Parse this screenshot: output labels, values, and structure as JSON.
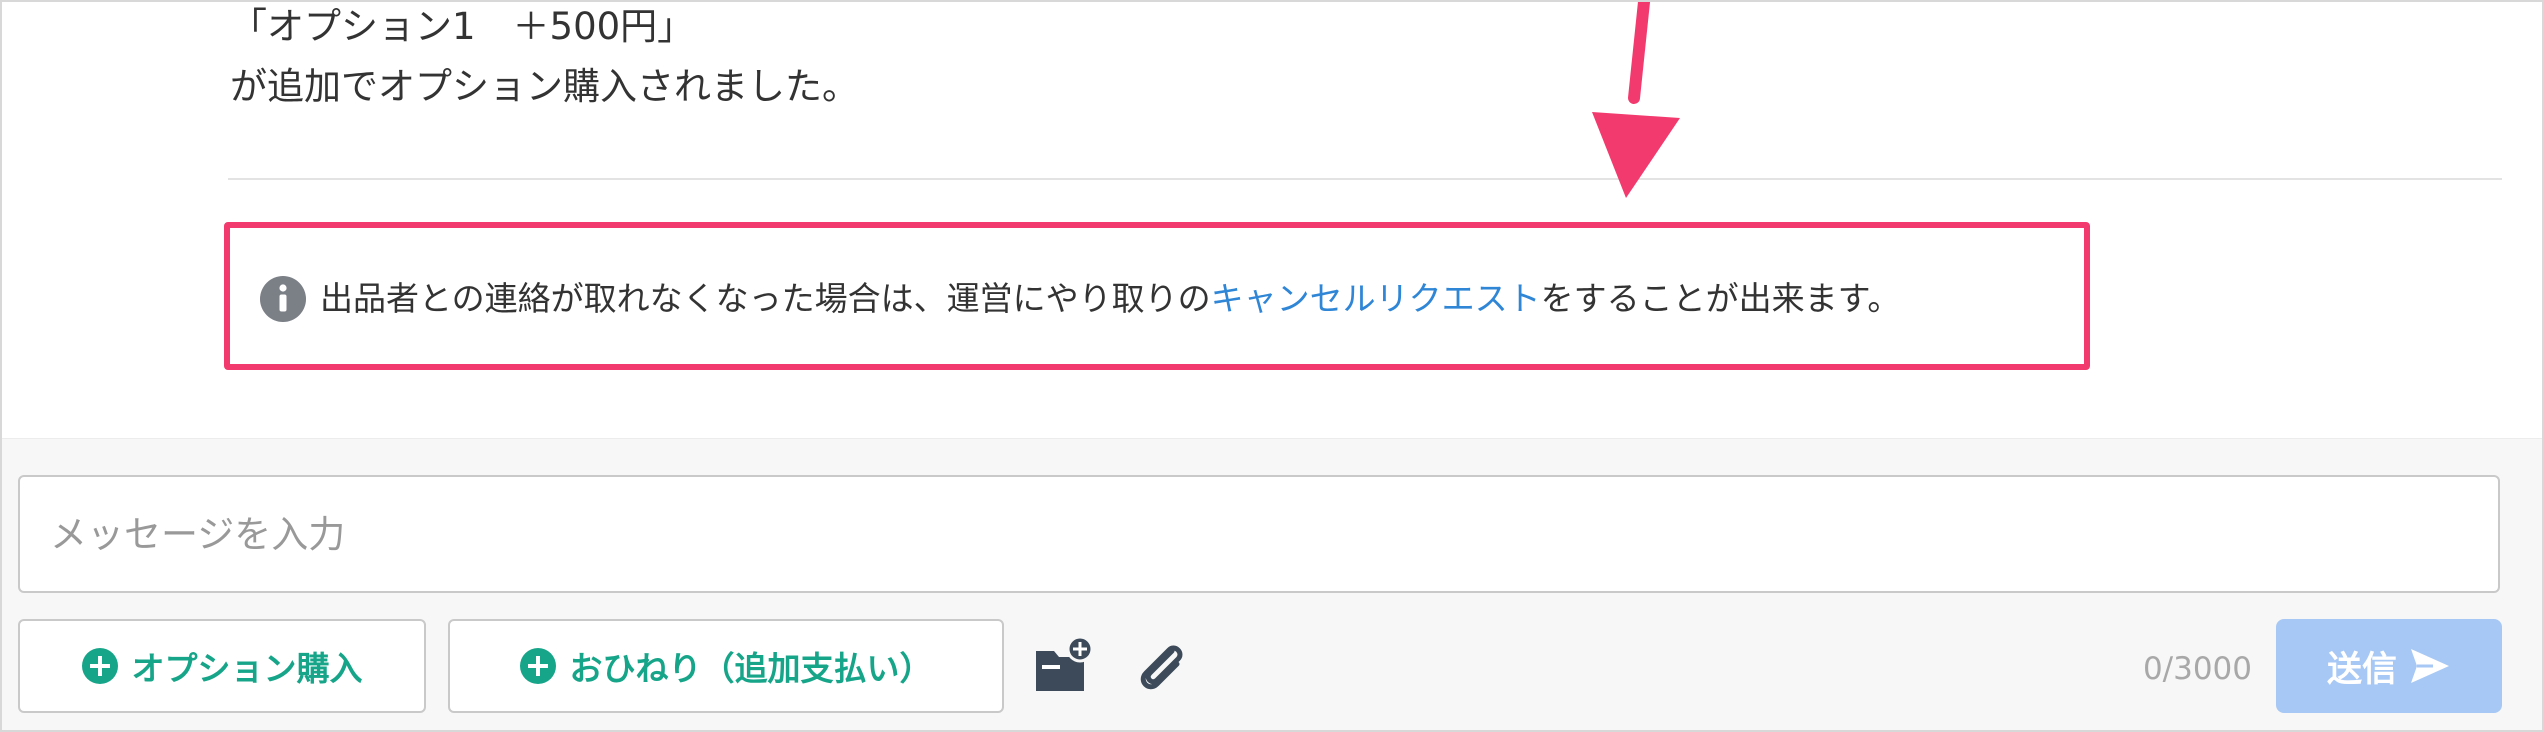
{
  "thread": {
    "message_line_1": "「オプション1　＋500円」",
    "message_line_2": "が追加でオプション購入されました。",
    "notice": {
      "text_before": "出品者との連絡が取れなくなった場合は、運営にやり取りの",
      "link_text": "キャンセルリクエスト",
      "text_after": "をすることが出来ます。"
    }
  },
  "composer": {
    "input_placeholder": "メッセージを入力",
    "input_value": "",
    "option_button_label": "オプション購入",
    "tip_button_label": "おひねり（追加支払い）",
    "char_counter": "0/3000",
    "send_button_label": "送信"
  },
  "colors": {
    "highlight_border": "#f23a6e",
    "link": "#2f86d6",
    "accent_green": "#17a589",
    "send_disabled": "#a7c8f5"
  },
  "icons": [
    "info-icon",
    "plus-circle-icon",
    "folder-plus-icon",
    "paperclip-icon",
    "send-icon",
    "annotation-arrow-icon"
  ]
}
